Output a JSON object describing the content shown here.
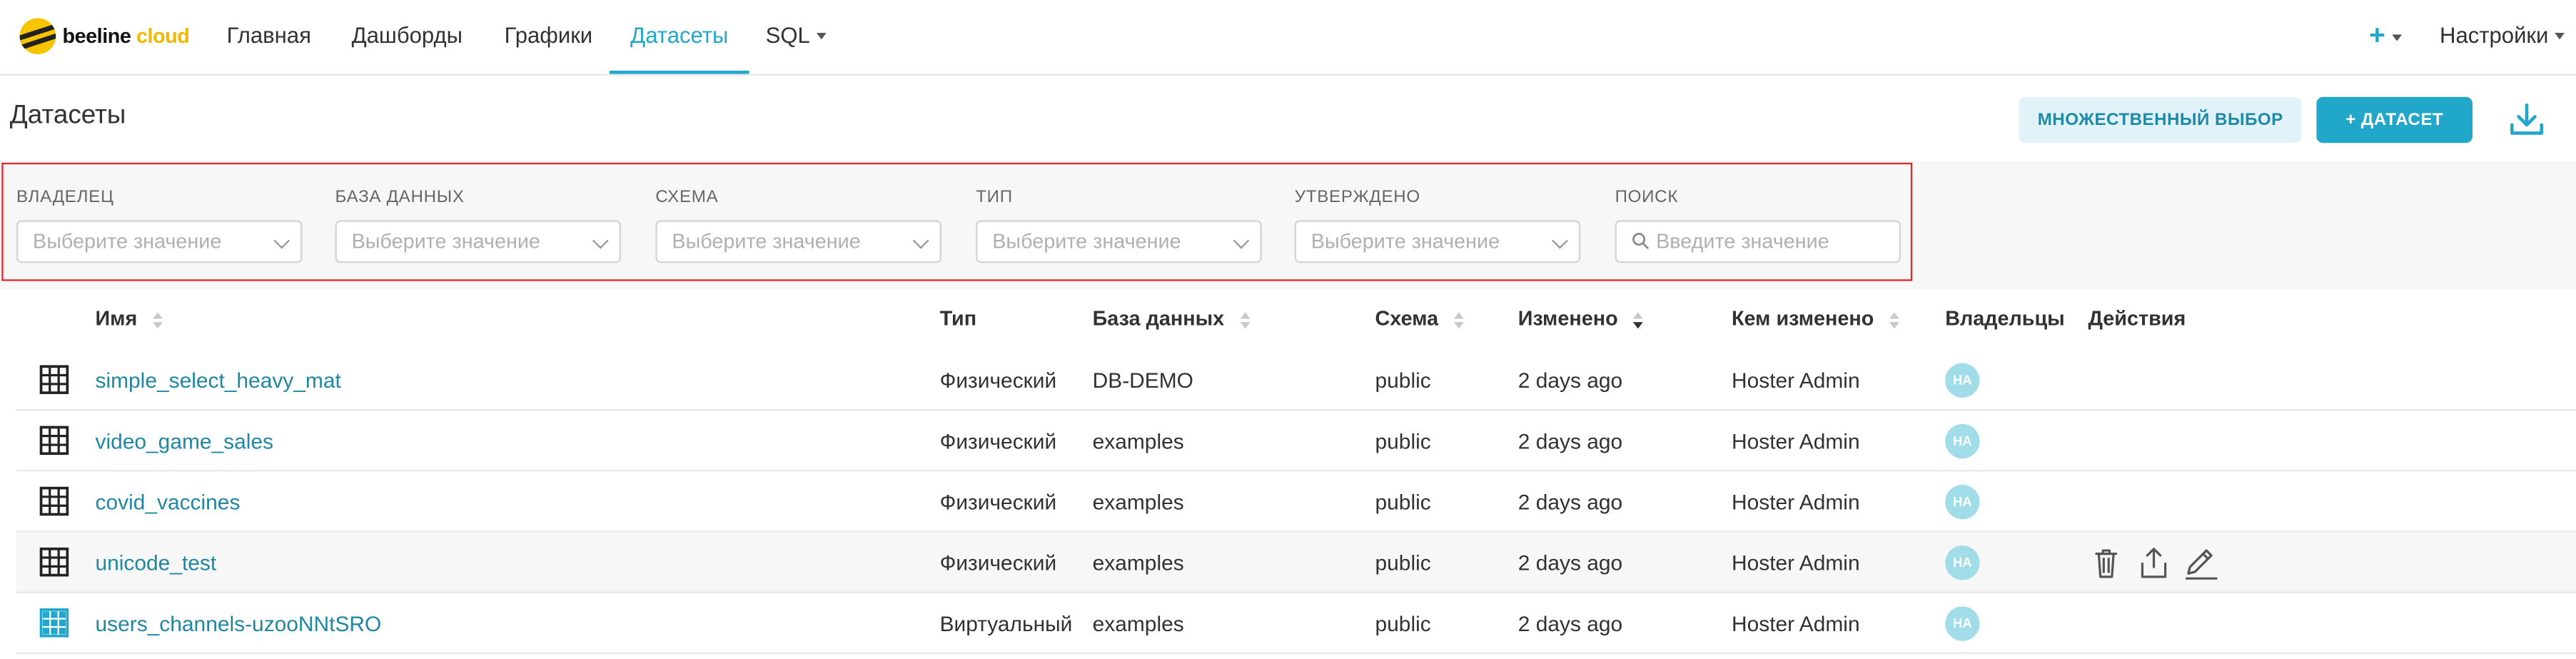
{
  "brand": {
    "name_part": "beeline",
    "accent_part": "cloud"
  },
  "nav": {
    "items": [
      {
        "label": "Главная"
      },
      {
        "label": "Дашборды"
      },
      {
        "label": "Графики"
      },
      {
        "label": "Датасеты"
      },
      {
        "label": "SQL"
      }
    ],
    "active": "Датасеты",
    "plus": "+",
    "settings": "Настройки"
  },
  "header": {
    "title": "Датасеты",
    "bulk_select": "МНОЖЕСТВЕННЫЙ ВЫБОР",
    "add_dataset": "+ ДАТАСЕТ"
  },
  "filters": [
    {
      "label": "ВЛАДЕЛЕЦ",
      "placeholder": "Выберите значение"
    },
    {
      "label": "БАЗА ДАННЫХ",
      "placeholder": "Выберите значение"
    },
    {
      "label": "СХЕМА",
      "placeholder": "Выберите значение"
    },
    {
      "label": "ТИП",
      "placeholder": "Выберите значение"
    },
    {
      "label": "УТВЕРЖДЕНО",
      "placeholder": "Выберите значение"
    },
    {
      "label": "ПОИСК",
      "placeholder": "Введите значение"
    }
  ],
  "table": {
    "columns": [
      "Имя",
      "Тип",
      "База данных",
      "Схема",
      "Изменено",
      "Кем изменено",
      "Владельцы",
      "Действия"
    ],
    "rows": [
      {
        "name": "simple_select_heavy_mat",
        "type": "Физический",
        "db": "DB-DEMO",
        "schema": "public",
        "changed": "2 days ago",
        "changed_by": "Hoster Admin",
        "owner": "HA",
        "kind": "physical"
      },
      {
        "name": "video_game_sales",
        "type": "Физический",
        "db": "examples",
        "schema": "public",
        "changed": "2 days ago",
        "changed_by": "Hoster Admin",
        "owner": "HA",
        "kind": "physical"
      },
      {
        "name": "covid_vaccines",
        "type": "Физический",
        "db": "examples",
        "schema": "public",
        "changed": "2 days ago",
        "changed_by": "Hoster Admin",
        "owner": "HA",
        "kind": "physical"
      },
      {
        "name": "unicode_test",
        "type": "Физический",
        "db": "examples",
        "schema": "public",
        "changed": "2 days ago",
        "changed_by": "Hoster Admin",
        "owner": "HA",
        "kind": "physical"
      },
      {
        "name": "users_channels-uzooNNtSRO",
        "type": "Виртуальный",
        "db": "examples",
        "schema": "public",
        "changed": "2 days ago",
        "changed_by": "Hoster Admin",
        "owner": "HA",
        "kind": "virtual"
      }
    ],
    "hovered_row": 3
  },
  "colors": {
    "accent": "#20a7c9",
    "link": "#1f87a3",
    "highlight_border": "#e0272a",
    "avatar": "#a0dde8"
  },
  "icons": {
    "grid": "table-grid-icon",
    "delete": "trash-icon",
    "export": "share-icon",
    "edit": "pencil-icon",
    "download": "download-icon",
    "search": "search-icon"
  }
}
